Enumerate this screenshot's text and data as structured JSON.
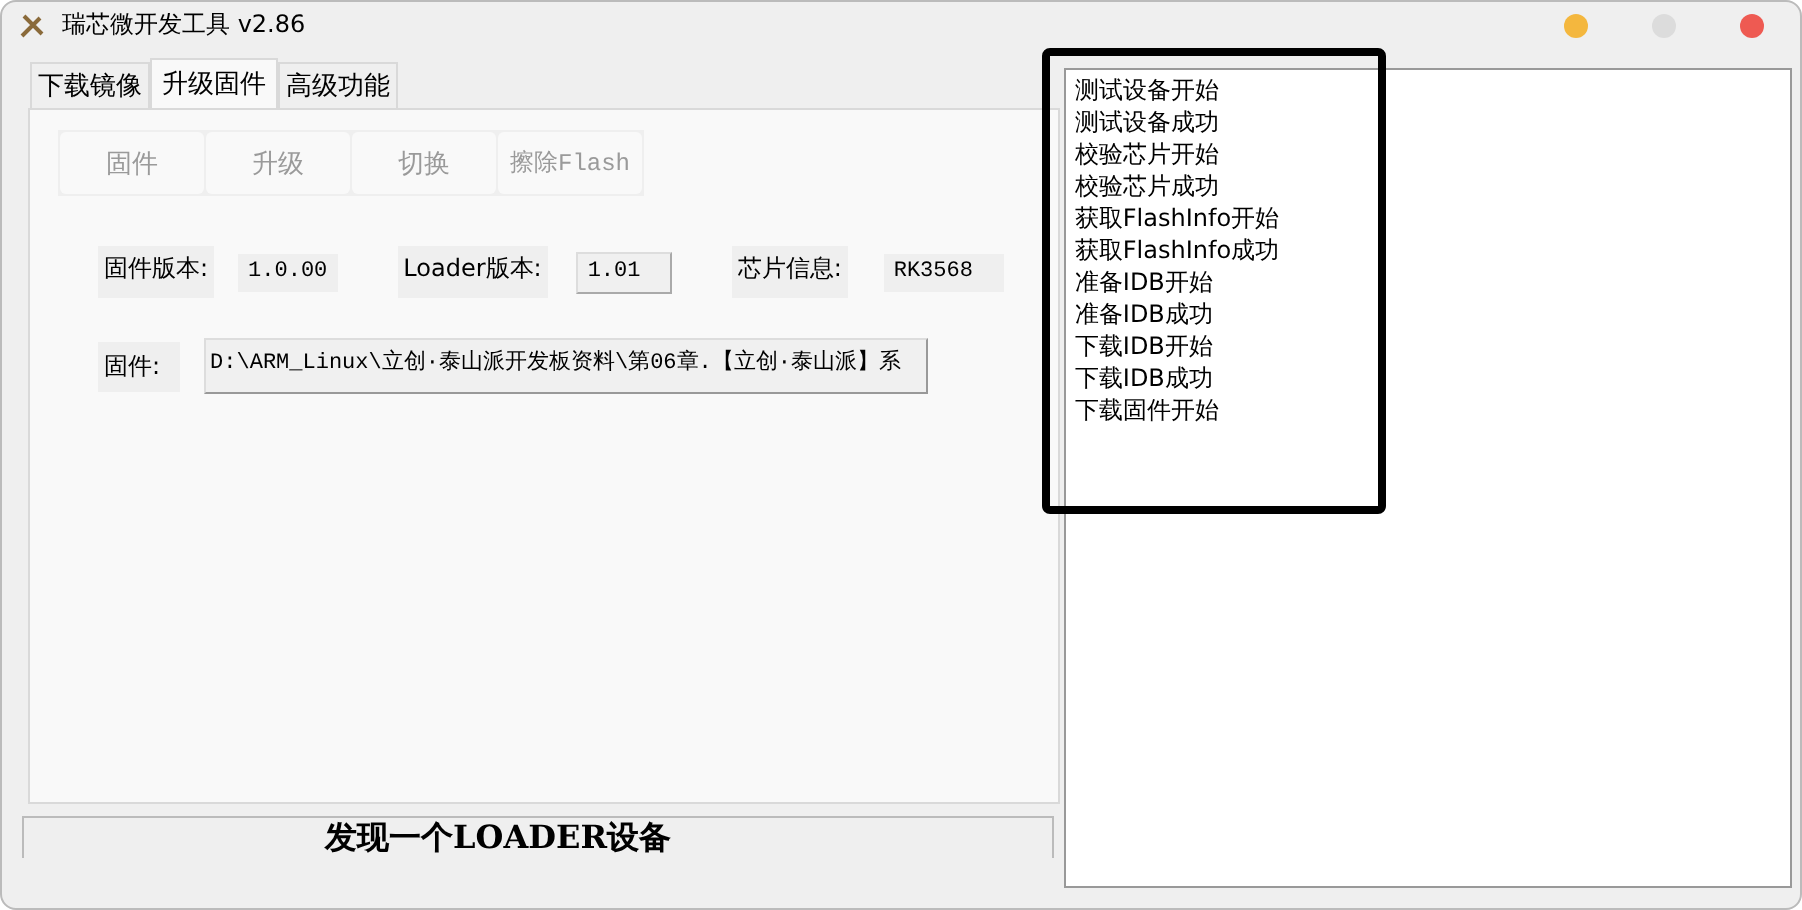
{
  "window": {
    "title": "瑞芯微开发工具 v2.86"
  },
  "tabs": [
    {
      "label": "下载镜像",
      "selected": false
    },
    {
      "label": "升级固件",
      "selected": true
    },
    {
      "label": "高级功能",
      "selected": false
    }
  ],
  "toolbar": [
    {
      "label": "固件",
      "disabled": true
    },
    {
      "label": "升级",
      "disabled": true
    },
    {
      "label": "切换",
      "disabled": true
    },
    {
      "label": "擦除Flash",
      "disabled": true
    }
  ],
  "info": [
    {
      "label": "固件版本:",
      "value": "1.0.00",
      "kind": "text"
    },
    {
      "label": "Loader版本:",
      "value": "1.01",
      "kind": "field"
    },
    {
      "label": "芯片信息:",
      "value": "RK3568",
      "kind": "text"
    }
  ],
  "firmware": {
    "label": "固件:",
    "value": "D:\\ARM_Linux\\立创·泰山派开发板资料\\第06章.【立创·泰山派】系"
  },
  "status_bar": {
    "text": "发现一个LOADER设备"
  },
  "log": [
    "测试设备开始",
    "测试设备成功",
    "校验芯片开始",
    "校验芯片成功",
    "获取FlashInfo开始",
    "获取FlashInfo成功",
    "准备IDB开始",
    "准备IDB成功",
    "下载IDB开始",
    "下载IDB成功",
    "下载固件开始"
  ]
}
